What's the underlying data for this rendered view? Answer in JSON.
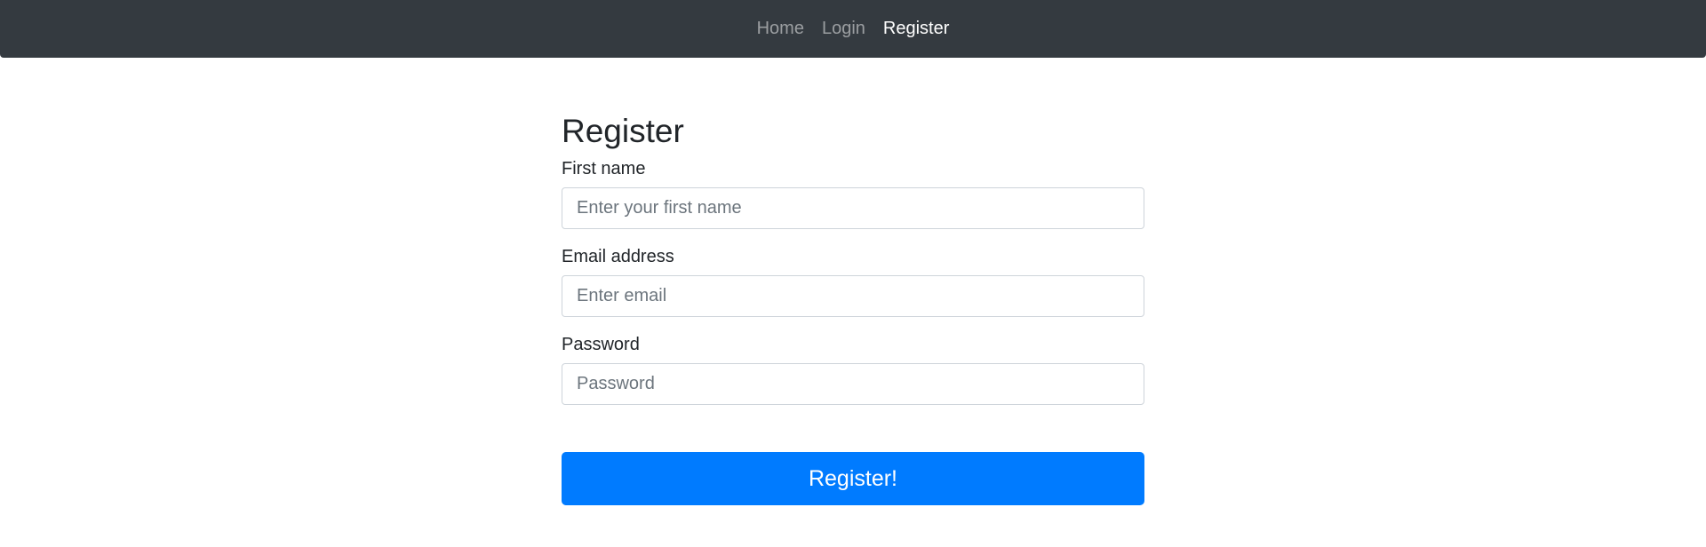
{
  "navbar": {
    "links": [
      {
        "label": "Home",
        "active": false
      },
      {
        "label": "Login",
        "active": false
      },
      {
        "label": "Register",
        "active": true
      }
    ]
  },
  "form": {
    "title": "Register",
    "fields": {
      "first_name": {
        "label": "First name",
        "placeholder": "Enter your first name",
        "value": ""
      },
      "email": {
        "label": "Email address",
        "placeholder": "Enter email",
        "value": ""
      },
      "password": {
        "label": "Password",
        "placeholder": "Password",
        "value": ""
      }
    },
    "submit_label": "Register!"
  },
  "colors": {
    "navbar_bg": "#343a40",
    "primary": "#007bff",
    "input_border": "#ced4da"
  }
}
